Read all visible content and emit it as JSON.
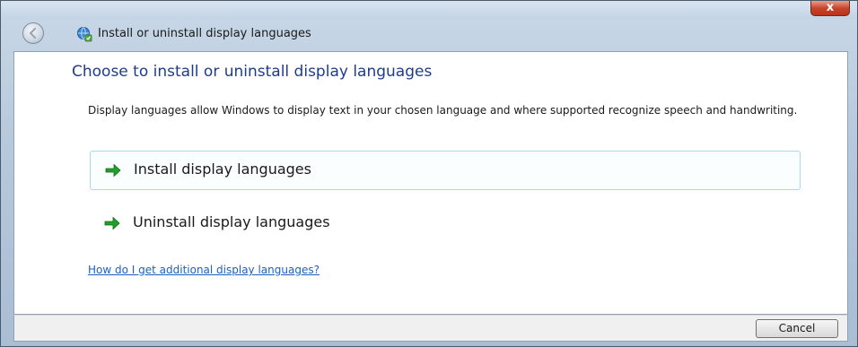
{
  "window": {
    "close_glyph": "x",
    "nav_title": "Install or uninstall display languages",
    "app_icon": "globe-language-icon"
  },
  "page": {
    "title": "Choose to install or uninstall display languages",
    "description": "Display languages allow Windows to display text in your chosen language and where supported recognize speech and handwriting."
  },
  "options": [
    {
      "label": "Install display languages",
      "icon": "green-arrow-icon",
      "highlighted": true
    },
    {
      "label": "Uninstall display languages",
      "icon": "green-arrow-icon",
      "highlighted": false
    }
  ],
  "help_link": "How do I get additional display languages?",
  "footer": {
    "cancel_label": "Cancel"
  }
}
